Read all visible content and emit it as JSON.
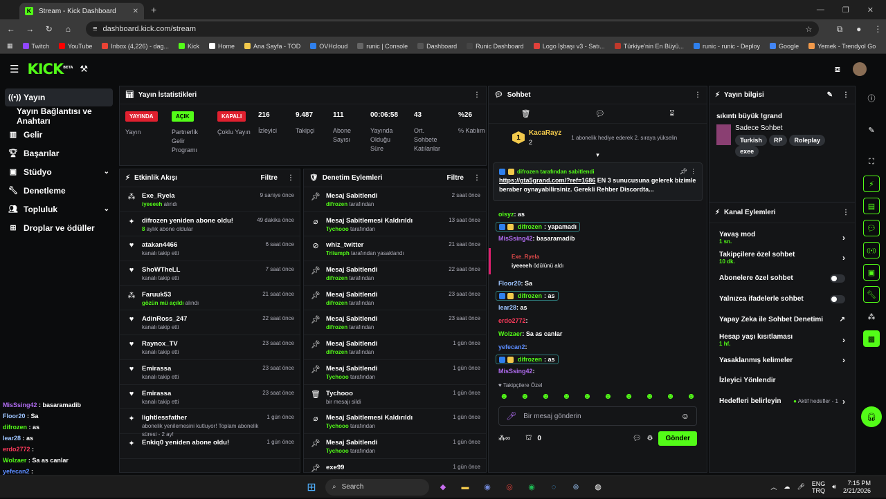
{
  "browser": {
    "tab_title": "Stream - Kick Dashboard",
    "url": "dashboard.kick.com/stream",
    "bookmarks": [
      "Twitch",
      "YouTube",
      "Inbox (4,226) - dag...",
      "Kick",
      "Home",
      "Ana Sayfa - TOD",
      "OVHcloud",
      "runic | Console",
      "Dashboard",
      "Runic Dashboard",
      "Logo İşbaşı v3 - Satı...",
      "Türkiye'nin En Büyü...",
      "runic - runic - Deploy",
      "Google",
      "Yemek - Trendyol Go"
    ]
  },
  "brand": {
    "logo": "KICK",
    "beta": "BETA",
    "accent": "#53fc18"
  },
  "sidebar": {
    "items": [
      {
        "label": "Yayın"
      },
      {
        "label": "Yayın Bağlantısı ve Anahtarı"
      },
      {
        "label": "Gelir"
      },
      {
        "label": "Başarılar"
      },
      {
        "label": "Stüdyo"
      },
      {
        "label": "Denetleme"
      },
      {
        "label": "Topluluk"
      },
      {
        "label": "Droplar ve ödüller"
      }
    ]
  },
  "overlay_chat": [
    {
      "user": "MisSsing42",
      "msg": "basaramadib",
      "color": "#b06cf0"
    },
    {
      "user": "Floor20",
      "msg": "Sa",
      "color": "#9ec5ff"
    },
    {
      "user": "difrozen",
      "msg": "as",
      "color": "#53fc18"
    },
    {
      "user": "lear28",
      "msg": "as",
      "color": "#9ec5ff"
    },
    {
      "user": "erdo2772",
      "msg": "",
      "color": "#ff3b5c"
    },
    {
      "user": "Wolzaer",
      "msg": "Sa as canlar",
      "color": "#53fc18"
    },
    {
      "user": "yefecan2",
      "msg": "",
      "color": "#5b8cff"
    },
    {
      "user": "difrozen",
      "msg": "as",
      "color": "#53fc18"
    },
    {
      "user": "MisSsing42",
      "msg": "",
      "color": "#b06cf0"
    }
  ],
  "stats": {
    "title": "Yayın İstatistikleri",
    "badges": [
      {
        "text": "YAYINDA",
        "label": "Yayın",
        "bg": "#e0202f"
      },
      {
        "text": "AÇIK",
        "label": "Partnerlik Gelir Programı",
        "bg": "#53fc18"
      },
      {
        "text": "KAPALI",
        "label": "Çoklu Yayın",
        "bg": "#e0202f"
      }
    ],
    "values": [
      {
        "value": "216",
        "label": "İzleyici"
      },
      {
        "value": "9.487",
        "label": "Takipçi"
      },
      {
        "value": "111",
        "label": "Abone Sayısı"
      },
      {
        "value": "00:06:58",
        "label": "Yayında Olduğu Süre"
      },
      {
        "value": "43",
        "label": "Ort. Sohbete Katılanlar"
      },
      {
        "value": "%26",
        "label": "% Katılım"
      }
    ]
  },
  "activity": {
    "title": "Etkinlik Akışı",
    "filter": "Filtre",
    "rows": [
      {
        "icon": "gift-icon",
        "title": "Exe_Ryela",
        "sub_b": "iyeeeeh",
        "sub": "alındı",
        "time": "9 saniye önce"
      },
      {
        "icon": "sparkle-icon",
        "title": "difrozen yeniden abone oldu!",
        "sub_b": "8",
        "sub": "aylık abone oldular",
        "time": "49 dakika önce"
      },
      {
        "icon": "heart-icon",
        "title": "atakan4466",
        "sub_b": "",
        "sub": "kanalı takip etti",
        "time": "6 saat önce"
      },
      {
        "icon": "heart-icon",
        "title": "ShoWTheLL",
        "sub_b": "",
        "sub": "kanalı takip etti",
        "time": "7 saat önce"
      },
      {
        "icon": "gift-icon",
        "title": "Faruuk53",
        "sub_b": "gözün mü açıldı",
        "sub": "alındı",
        "time": "21 saat önce"
      },
      {
        "icon": "heart-icon",
        "title": "AdinRoss_247",
        "sub_b": "",
        "sub": "kanalı takip etti",
        "time": "22 saat önce"
      },
      {
        "icon": "heart-icon",
        "title": "Raynox_TV",
        "sub_b": "",
        "sub": "kanalı takip etti",
        "time": "23 saat önce"
      },
      {
        "icon": "heart-icon",
        "title": "Emirassa",
        "sub_b": "",
        "sub": "kanalı takip etti",
        "time": "23 saat önce"
      },
      {
        "icon": "heart-icon",
        "title": "Emirassa",
        "sub_b": "",
        "sub": "kanalı takip etti",
        "time": "23 saat önce"
      },
      {
        "icon": "sparkle-icon",
        "title": "lightlessfather",
        "sub_b": "",
        "sub": "abonelik yenilemesini kutluyor! Toplam abonelik süresi - 2 ay!",
        "time": "1 gün önce"
      },
      {
        "icon": "sparkle-icon",
        "title": "Enkiq0 yeniden abone oldu!",
        "sub_b": "",
        "sub": "",
        "time": "1 gün önce"
      }
    ]
  },
  "moderation": {
    "title": "Denetim Eylemleri",
    "filter": "Filtre",
    "rows": [
      {
        "icon": "pin-icon",
        "title": "Mesaj Sabitlendi",
        "sub_b": "difrozen",
        "sub": "tarafından",
        "time": "2 saat önce"
      },
      {
        "icon": "unpin-icon",
        "title": "Mesaj Sabitlemesi Kaldırıldı",
        "sub_b": "Tychooo",
        "sub": "tarafından",
        "time": "13 saat önce"
      },
      {
        "icon": "ban-icon",
        "title": "whiz_twitter",
        "sub_b": "Triiumph",
        "sub": "tarafından yasaklandı",
        "time": "21 saat önce"
      },
      {
        "icon": "pin-icon",
        "title": "Mesaj Sabitlendi",
        "sub_b": "difrozen",
        "sub": "tarafından",
        "time": "22 saat önce"
      },
      {
        "icon": "pin-icon",
        "title": "Mesaj Sabitlendi",
        "sub_b": "difrozen",
        "sub": "tarafından",
        "time": "23 saat önce"
      },
      {
        "icon": "pin-icon",
        "title": "Mesaj Sabitlendi",
        "sub_b": "difrozen",
        "sub": "tarafından",
        "time": "23 saat önce"
      },
      {
        "icon": "pin-icon",
        "title": "Mesaj Sabitlendi",
        "sub_b": "difrozen",
        "sub": "tarafından",
        "time": "1 gün önce"
      },
      {
        "icon": "pin-icon",
        "title": "Mesaj Sabitlendi",
        "sub_b": "Tychooo",
        "sub": "tarafından",
        "time": "1 gün önce"
      },
      {
        "icon": "trash-icon",
        "title": "Tychooo",
        "sub_b": "",
        "sub": "bir mesajı sildi",
        "time": "1 gün önce"
      },
      {
        "icon": "unpin-icon",
        "title": "Mesaj Sabitlemesi Kaldırıldı",
        "sub_b": "Tychooo",
        "sub": "tarafından",
        "time": "1 gün önce"
      },
      {
        "icon": "pin-icon",
        "title": "Mesaj Sabitlendi",
        "sub_b": "Tychooo",
        "sub": "tarafından",
        "time": "1 gün önce"
      },
      {
        "icon": "pin-icon",
        "title": "exe99",
        "sub_b": "",
        "sub": "",
        "time": "1 gün önce"
      }
    ]
  },
  "chat": {
    "title": "Sohbet",
    "top_user": "KacaRayz",
    "top_rank": "1",
    "top_count": "2",
    "gift_text": "1 abonelik hediye ederek 2. sıraya yükselin",
    "pinned_by": "difrozen tarafından sabitlendi",
    "pinned_link": "https://gta5grand.com/?ref=1686",
    "pinned_text": " EN 3 sunucusuna gelerek bizimle beraber oynayabilirsiniz. Gerekli Rehber Discordta...",
    "messages": [
      {
        "user": "oisyz",
        "msg": "as",
        "color": "#53fc18",
        "pill": false
      },
      {
        "user": "difrozen",
        "msg": "yapamadı",
        "color": "#53fc18",
        "pill": true
      },
      {
        "user": "MisSsing42",
        "msg": "basaramadib",
        "color": "#b06cf0",
        "pill": false
      }
    ],
    "redeem_user": "Exe_Ryela",
    "redeem_text": "iyeeeeh",
    "redeem_suffix": " ödülünü aldı",
    "messages2": [
      {
        "user": "Floor20",
        "msg": "Sa",
        "color": "#9ec5ff",
        "pill": false
      },
      {
        "user": "difrozen",
        "msg": "as",
        "color": "#53fc18",
        "pill": true
      },
      {
        "user": "lear28",
        "msg": "as",
        "color": "#9ec5ff",
        "pill": false
      },
      {
        "user": "erdo2772",
        "msg": "",
        "color": "#ff3b5c",
        "pill": false
      },
      {
        "user": "Wolzaer",
        "msg": "Sa as canlar",
        "color": "#53fc18",
        "pill": false
      },
      {
        "user": "yefecan2",
        "msg": "",
        "color": "#5b8cff",
        "pill": false
      },
      {
        "user": "difrozen",
        "msg": "as",
        "color": "#53fc18",
        "pill": true
      },
      {
        "user": "MisSsing42",
        "msg": "",
        "color": "#b06cf0",
        "pill": false
      }
    ],
    "followers_only": "Takipçilere Özel",
    "input_placeholder": "Bir mesaj gönderin",
    "points": "0",
    "send": "Gönder"
  },
  "stream_info": {
    "title": "Yayın bilgisi",
    "stream_title": "sıkıntı büyük !grand",
    "category": "Sadece Sohbet",
    "tags": [
      "Turkish",
      "RP",
      "Roleplay",
      "exee"
    ]
  },
  "channel_actions": {
    "title": "Kanal Eylemleri",
    "rows": [
      {
        "label": "Yavaş mod",
        "sub": "1 sn.",
        "ctrl": "arrow"
      },
      {
        "label": "Takipçilere özel sohbet",
        "sub": "10 dk.",
        "ctrl": "arrow"
      },
      {
        "label": "Abonelere özel sohbet",
        "sub": "",
        "ctrl": "toggle"
      },
      {
        "label": "Yalnızca ifadelerle sohbet",
        "sub": "",
        "ctrl": "toggle"
      },
      {
        "label": "Yapay Zeka ile Sohbet Denetimi",
        "sub": "",
        "ctrl": "ext"
      },
      {
        "label": "Hesap yaşı kısıtlaması",
        "sub": "1 hf.",
        "ctrl": "arrow"
      },
      {
        "label": "Yasaklanmış kelimeler",
        "sub": "",
        "ctrl": "arrow"
      },
      {
        "label": "İzleyici Yönlendir",
        "sub": "",
        "ctrl": "none"
      },
      {
        "label": "Hedefleri belirleyin",
        "sub": "",
        "ctrl": "goal"
      }
    ],
    "goal_text": "Aktif hedefler - 1"
  },
  "taskbar": {
    "search": "Search",
    "lang": "ENG",
    "lang2": "TRQ",
    "time": "7:15 PM",
    "date": "2/21/2026"
  }
}
